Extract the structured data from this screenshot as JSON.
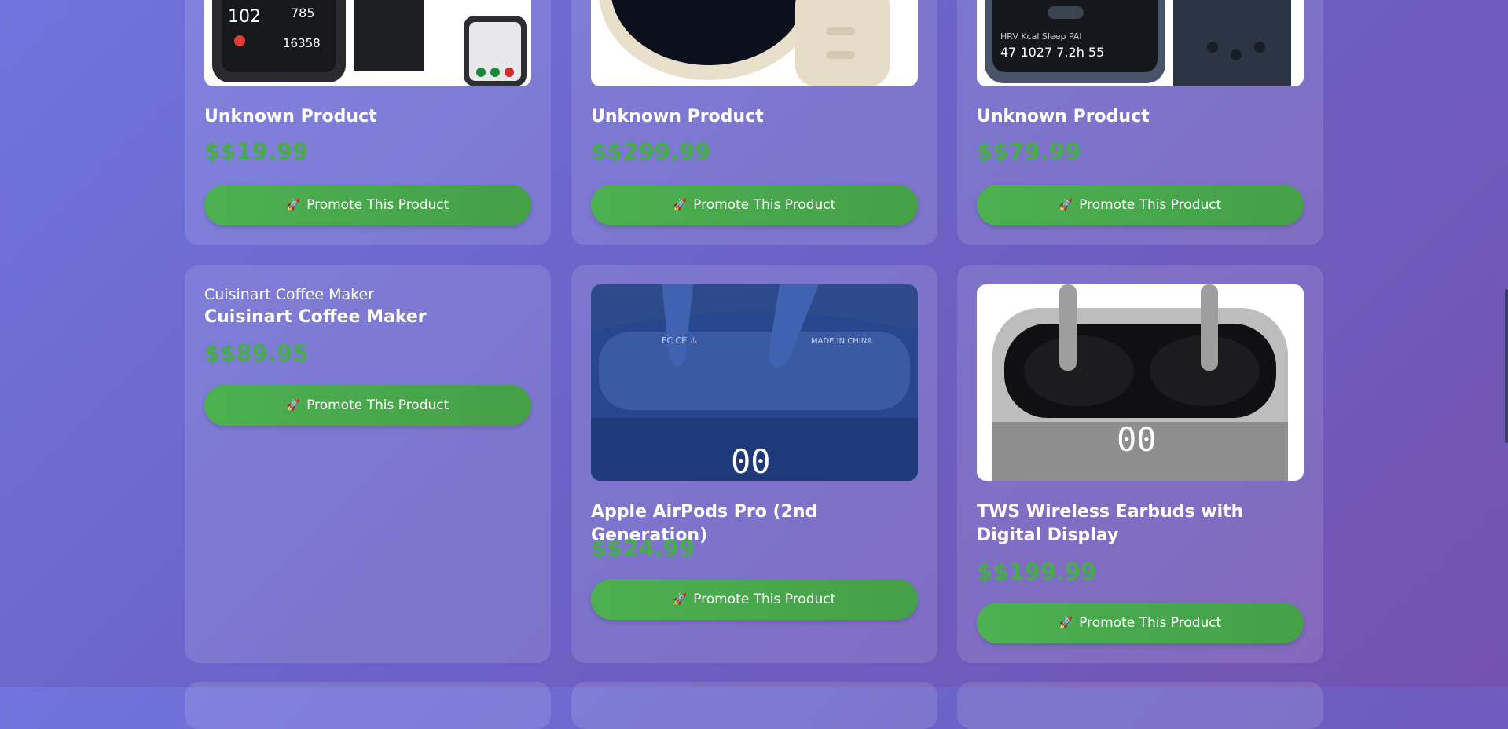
{
  "products": [
    {
      "title": "Unknown Product",
      "price": "$$19.99",
      "button": "Promote This Product",
      "button_icon": "rocket-icon",
      "image": "black-square-smartwatch"
    },
    {
      "title": "Unknown Product",
      "price": "$$299.99",
      "button": "Promote This Product",
      "button_icon": "rocket-icon",
      "image": "cream-round-smartwatch"
    },
    {
      "title": "Unknown Product",
      "price": "$$79.99",
      "button": "Promote This Product",
      "button_icon": "rocket-icon",
      "image": "dark-square-smartwatch"
    },
    {
      "subtitle": "Cuisinart Coffee Maker",
      "title": "Cuisinart Coffee Maker",
      "price": "$$89.95",
      "button": "Promote This Product",
      "button_icon": "rocket-icon"
    },
    {
      "title": "Apple AirPods Pro (2nd Generation)",
      "price": "$$24.99",
      "button": "Promote This Product",
      "button_icon": "rocket-icon",
      "image": "blue-earbuds-case"
    },
    {
      "title": "TWS Wireless Earbuds with Digital Display",
      "price": "$$199.99",
      "button": "Promote This Product",
      "button_icon": "rocket-icon",
      "image": "black-earbuds-case"
    }
  ],
  "colors": {
    "price": "#46ad4a",
    "button": "#4cb050",
    "background_start": "#7074dc",
    "background_end": "#7452b0"
  }
}
